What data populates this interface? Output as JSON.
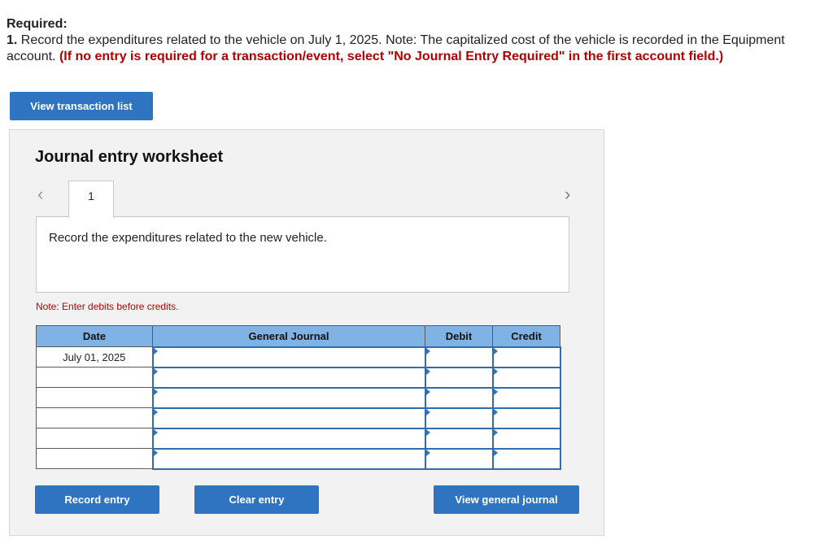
{
  "required": {
    "title": "Required:",
    "number": "1.",
    "text": " Record the expenditures related to the vehicle on July 1, 2025. Note: The capitalized cost of the vehicle is recorded in the Equipment account. ",
    "emphasis": "(If no entry is required for a transaction/event, select \"No Journal Entry Required\" in the first account field.)"
  },
  "view_transaction_list_label": "View transaction list",
  "worksheet": {
    "title": "Journal entry worksheet",
    "nav_prev_icon": "‹",
    "nav_next_icon": "›",
    "tabs": [
      {
        "label": "1"
      }
    ],
    "description": "Record the expenditures related to the new vehicle.",
    "note": "Note: Enter debits before credits.",
    "table": {
      "headers": {
        "date": "Date",
        "general_journal": "General Journal",
        "debit": "Debit",
        "credit": "Credit"
      },
      "rows": [
        {
          "date": "July 01, 2025",
          "account": "",
          "debit": "",
          "credit": ""
        },
        {
          "date": "",
          "account": "",
          "debit": "",
          "credit": ""
        },
        {
          "date": "",
          "account": "",
          "debit": "",
          "credit": ""
        },
        {
          "date": "",
          "account": "",
          "debit": "",
          "credit": ""
        },
        {
          "date": "",
          "account": "",
          "debit": "",
          "credit": ""
        },
        {
          "date": "",
          "account": "",
          "debit": "",
          "credit": ""
        }
      ]
    },
    "buttons": {
      "record_entry": "Record entry",
      "clear_entry": "Clear entry",
      "view_general_journal": "View general journal"
    }
  }
}
